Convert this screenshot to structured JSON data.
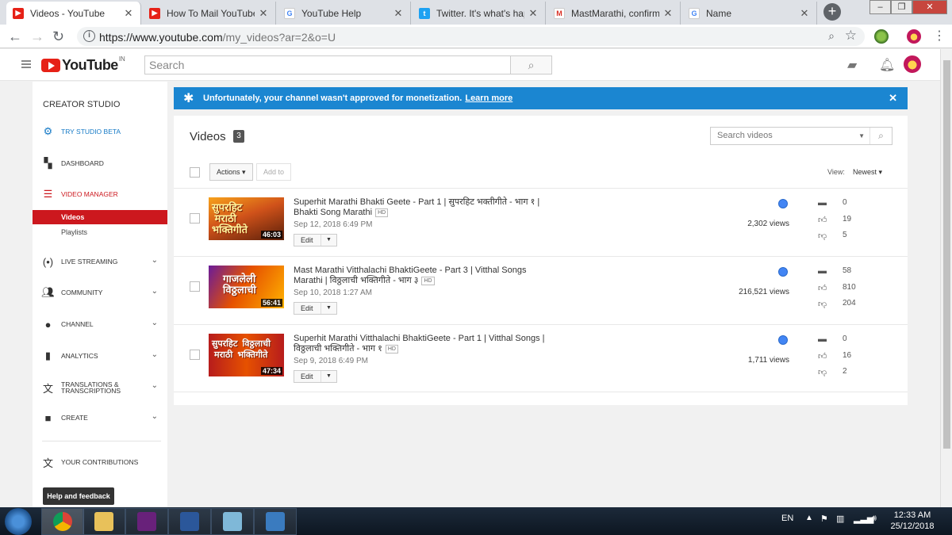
{
  "browser": {
    "tabs": [
      {
        "title": "Videos - YouTube",
        "favicon": "youtube-icon",
        "active": true
      },
      {
        "title": "How To Mail YouTube Fo",
        "favicon": "youtube-icon",
        "active": false
      },
      {
        "title": "YouTube Help",
        "favicon": "google-icon",
        "active": false
      },
      {
        "title": "Twitter. It's what's happ",
        "favicon": "twitter-icon",
        "active": false
      },
      {
        "title": "MastMarathi, confirm yo",
        "favicon": "gmail-icon",
        "active": false
      },
      {
        "title": "Name",
        "favicon": "google-icon",
        "active": false
      }
    ],
    "url_host": "https://www.youtube.com",
    "url_path": "/my_videos?ar=2&o=U"
  },
  "header": {
    "logo_text": "YouTube",
    "logo_country": "IN",
    "search_placeholder": "Search"
  },
  "sidebar": {
    "title": "CREATOR STUDIO",
    "items": [
      {
        "label": "TRY STUDIO BETA",
        "icon": "gear-icon"
      },
      {
        "label": "DASHBOARD",
        "icon": "dashboard-icon"
      },
      {
        "label": "VIDEO MANAGER",
        "icon": "video-manager-icon"
      },
      {
        "label": "LIVE STREAMING",
        "icon": "live-icon"
      },
      {
        "label": "COMMUNITY",
        "icon": "community-icon"
      },
      {
        "label": "CHANNEL",
        "icon": "channel-icon"
      },
      {
        "label": "ANALYTICS",
        "icon": "analytics-icon"
      },
      {
        "label": "TRANSLATIONS & TRANSCRIPTIONS",
        "icon": "translate-icon"
      },
      {
        "label": "CREATE",
        "icon": "create-icon"
      },
      {
        "label": "YOUR CONTRIBUTIONS",
        "icon": "contributions-icon"
      }
    ],
    "sub_videos": "Videos",
    "sub_playlists": "Playlists",
    "help": "Help and feedback"
  },
  "banner": {
    "message": "Unfortunately, your channel wasn't approved for monetization.",
    "link": "Learn more"
  },
  "videos": {
    "title": "Videos",
    "count": "3",
    "search_placeholder": "Search videos",
    "actions_label": "Actions",
    "add_to_label": "Add to",
    "view_label": "View:",
    "view_value": "Newest",
    "edit_label": "Edit",
    "list": [
      {
        "title": "Superhit Marathi Bhakti Geete - Part 1 | सुपरहिट भक्तीगीते - भाग १ | Bhakti Song Marathi",
        "hd": "HD",
        "date": "Sep 12, 2018 6:49 PM",
        "duration": "46:03",
        "views": "2,302 views",
        "comments": "0",
        "likes": "19",
        "dislikes": "5"
      },
      {
        "title": "Mast Marathi Vitthalachi BhaktiGeete - Part 3 | Vitthal Songs Marathi | विठ्ठलाची भक्तिगीते - भाग ३",
        "hd": "HD",
        "date": "Sep 10, 2018 1:27 AM",
        "duration": "56:41",
        "views": "216,521 views",
        "comments": "58",
        "likes": "810",
        "dislikes": "204"
      },
      {
        "title": "Superhit Marathi Vitthalachi BhaktiGeete - Part 1 | Vitthal Songs | विठ्ठलाची भक्तिगीते - भाग १",
        "hd": "HD",
        "date": "Sep 9, 2018 6:49 PM",
        "duration": "47:34",
        "views": "1,711 views",
        "comments": "0",
        "likes": "16",
        "dislikes": "2"
      }
    ]
  },
  "taskbar": {
    "lang": "EN",
    "time": "12:33 AM",
    "date": "25/12/2018"
  }
}
